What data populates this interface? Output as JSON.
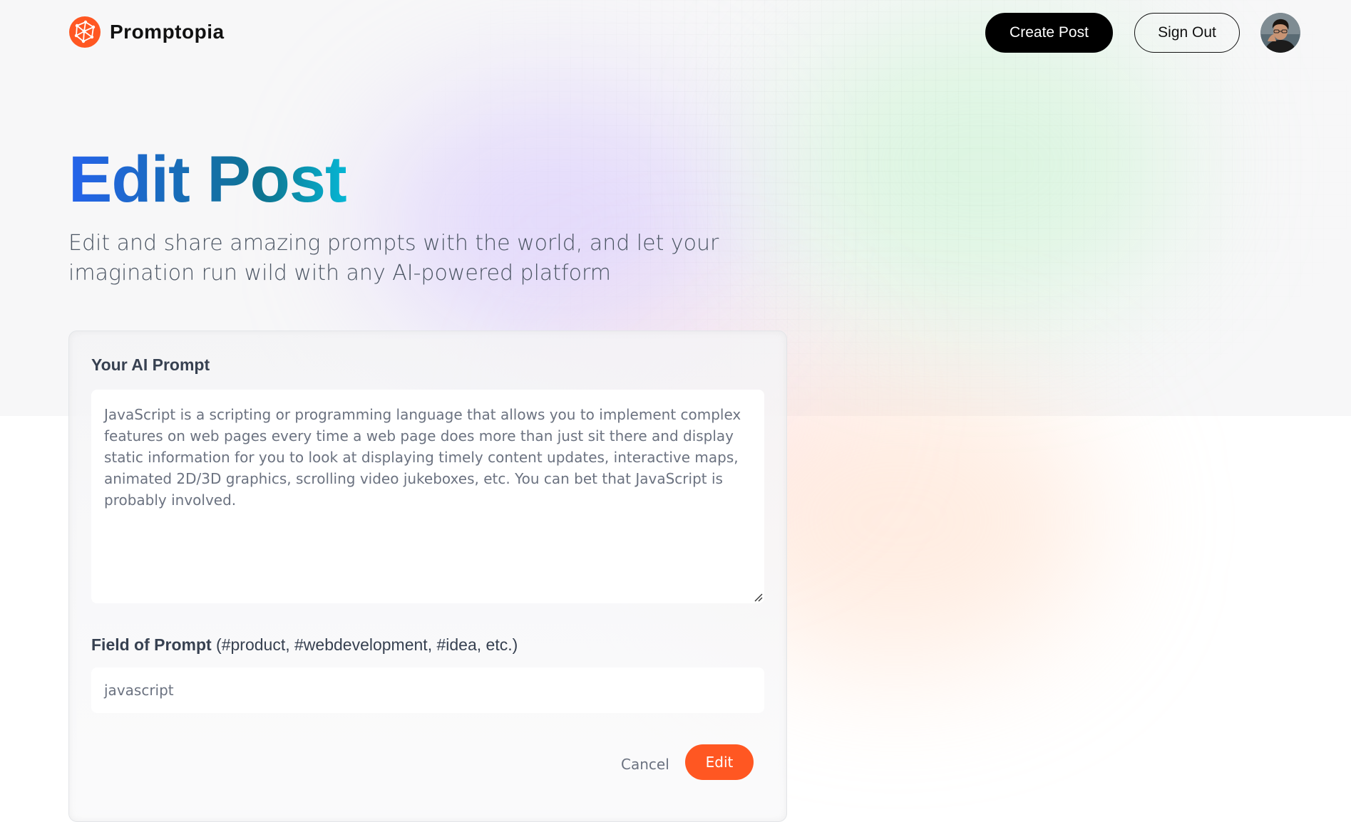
{
  "header": {
    "brand_name": "Promptopia",
    "create_post_label": "Create Post",
    "sign_out_label": "Sign Out"
  },
  "hero": {
    "title": "Edit Post",
    "subtitle": "Edit and share amazing prompts with the world, and let your imagination run wild with any AI-powered platform"
  },
  "form": {
    "prompt_label": "Your AI Prompt",
    "prompt_value": "JavaScript is a scripting or programming language that allows you to implement complex features on web pages every time a web page does more than just sit there and display static information for you to look at displaying timely content updates, interactive maps, animated 2D/3D graphics, scrolling video jukeboxes, etc. You can bet that JavaScript is probably involved.",
    "field_label": "Field of Prompt",
    "field_hint": " (#product, #webdevelopment, #idea, etc.)",
    "field_value": "javascript",
    "cancel_label": "Cancel",
    "submit_label": "Edit"
  },
  "colors": {
    "accent": "#ff5722",
    "title_gradient_start": "#2563eb",
    "title_gradient_end": "#06b6d4"
  },
  "icons": {
    "logo": "promptopia-logo-icon",
    "resize": "resize-handle-icon",
    "avatar": "user-avatar"
  }
}
